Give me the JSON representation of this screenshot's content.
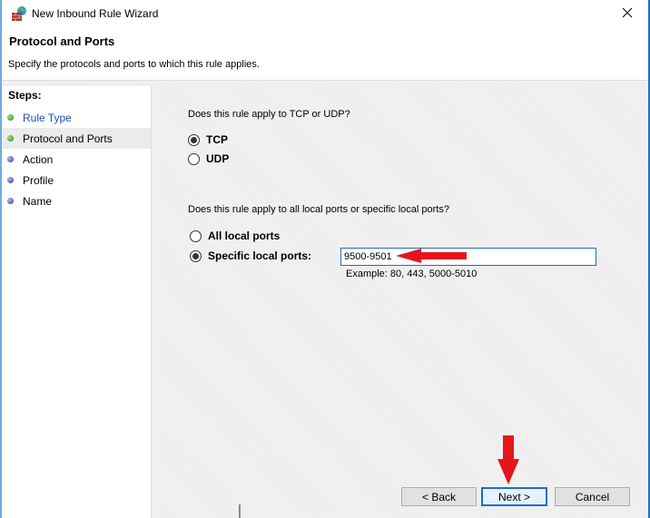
{
  "window": {
    "title": "New Inbound Rule Wizard",
    "icon": "firewall-globe-icon",
    "close_icon": "close-icon"
  },
  "header": {
    "title": "Protocol and Ports",
    "description": "Specify the protocols and ports to which this rule applies."
  },
  "steps": {
    "heading": "Steps:",
    "items": [
      {
        "label": "Rule Type",
        "state": "done",
        "link": true
      },
      {
        "label": "Protocol and Ports",
        "state": "current",
        "link": false
      },
      {
        "label": "Action",
        "state": "pending",
        "link": false
      },
      {
        "label": "Profile",
        "state": "pending",
        "link": false
      },
      {
        "label": "Name",
        "state": "pending",
        "link": false
      }
    ]
  },
  "protocol": {
    "question": "Does this rule apply to TCP or UDP?",
    "options": [
      {
        "label": "TCP",
        "checked": true
      },
      {
        "label": "UDP",
        "checked": false
      }
    ]
  },
  "ports": {
    "question": "Does this rule apply to all local ports or specific local ports?",
    "options": [
      {
        "label": "All local ports",
        "checked": false
      },
      {
        "label": "Specific local ports:",
        "checked": true
      }
    ],
    "value": "9500-9501",
    "example": "Example: 80, 443, 5000-5010"
  },
  "buttons": {
    "back": "< Back",
    "next": "Next >",
    "cancel": "Cancel"
  },
  "annotations": {
    "arrow_color": "#e8141c"
  }
}
